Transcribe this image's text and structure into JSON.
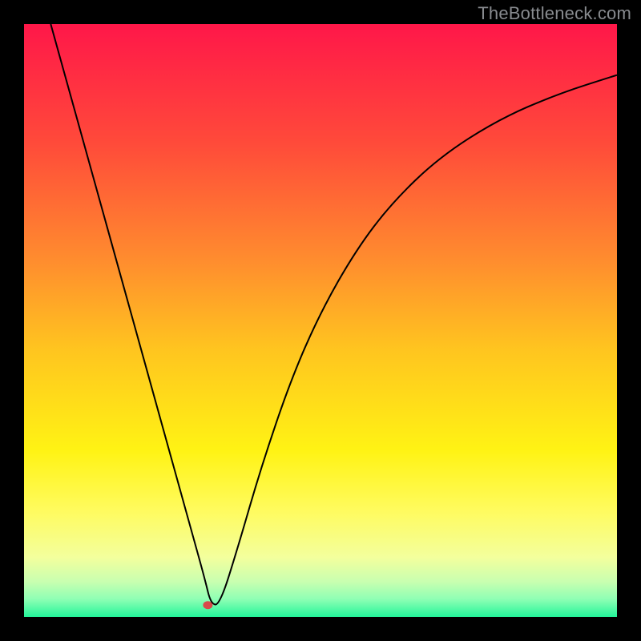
{
  "watermark": "TheBottleneck.com",
  "chart_data": {
    "type": "line",
    "title": "",
    "xlabel": "",
    "ylabel": "",
    "xlim": [
      0,
      100
    ],
    "ylim": [
      0,
      100
    ],
    "grid": false,
    "axes_visible": false,
    "background_gradient": {
      "stops": [
        {
          "offset": 0.0,
          "color": "#ff1749"
        },
        {
          "offset": 0.2,
          "color": "#ff4a3a"
        },
        {
          "offset": 0.4,
          "color": "#ff8d2e"
        },
        {
          "offset": 0.55,
          "color": "#ffc51f"
        },
        {
          "offset": 0.72,
          "color": "#fff314"
        },
        {
          "offset": 0.82,
          "color": "#fffb5e"
        },
        {
          "offset": 0.9,
          "color": "#f3ff9d"
        },
        {
          "offset": 0.94,
          "color": "#c9ffb0"
        },
        {
          "offset": 0.97,
          "color": "#8effb4"
        },
        {
          "offset": 1.0,
          "color": "#23f59a"
        }
      ]
    },
    "series": [
      {
        "name": "bottleneck-curve",
        "color": "#000000",
        "x": [
          4.5,
          8,
          12,
          16,
          20,
          24,
          27.8,
          30.5,
          31.5,
          33,
          36,
          40,
          45,
          50,
          56,
          62,
          70,
          80,
          90,
          100
        ],
        "y": [
          100,
          87.4,
          73,
          58.6,
          44.2,
          29.8,
          16.1,
          6.4,
          2.2,
          2.0,
          11.5,
          25.3,
          40.0,
          51.4,
          61.9,
          69.8,
          77.5,
          83.9,
          88.2,
          91.4
        ]
      }
    ],
    "marker": {
      "name": "minimum-point",
      "x": 31.0,
      "y": 2.0,
      "color": "#d84a4a",
      "rx": 6,
      "ry": 5
    }
  }
}
